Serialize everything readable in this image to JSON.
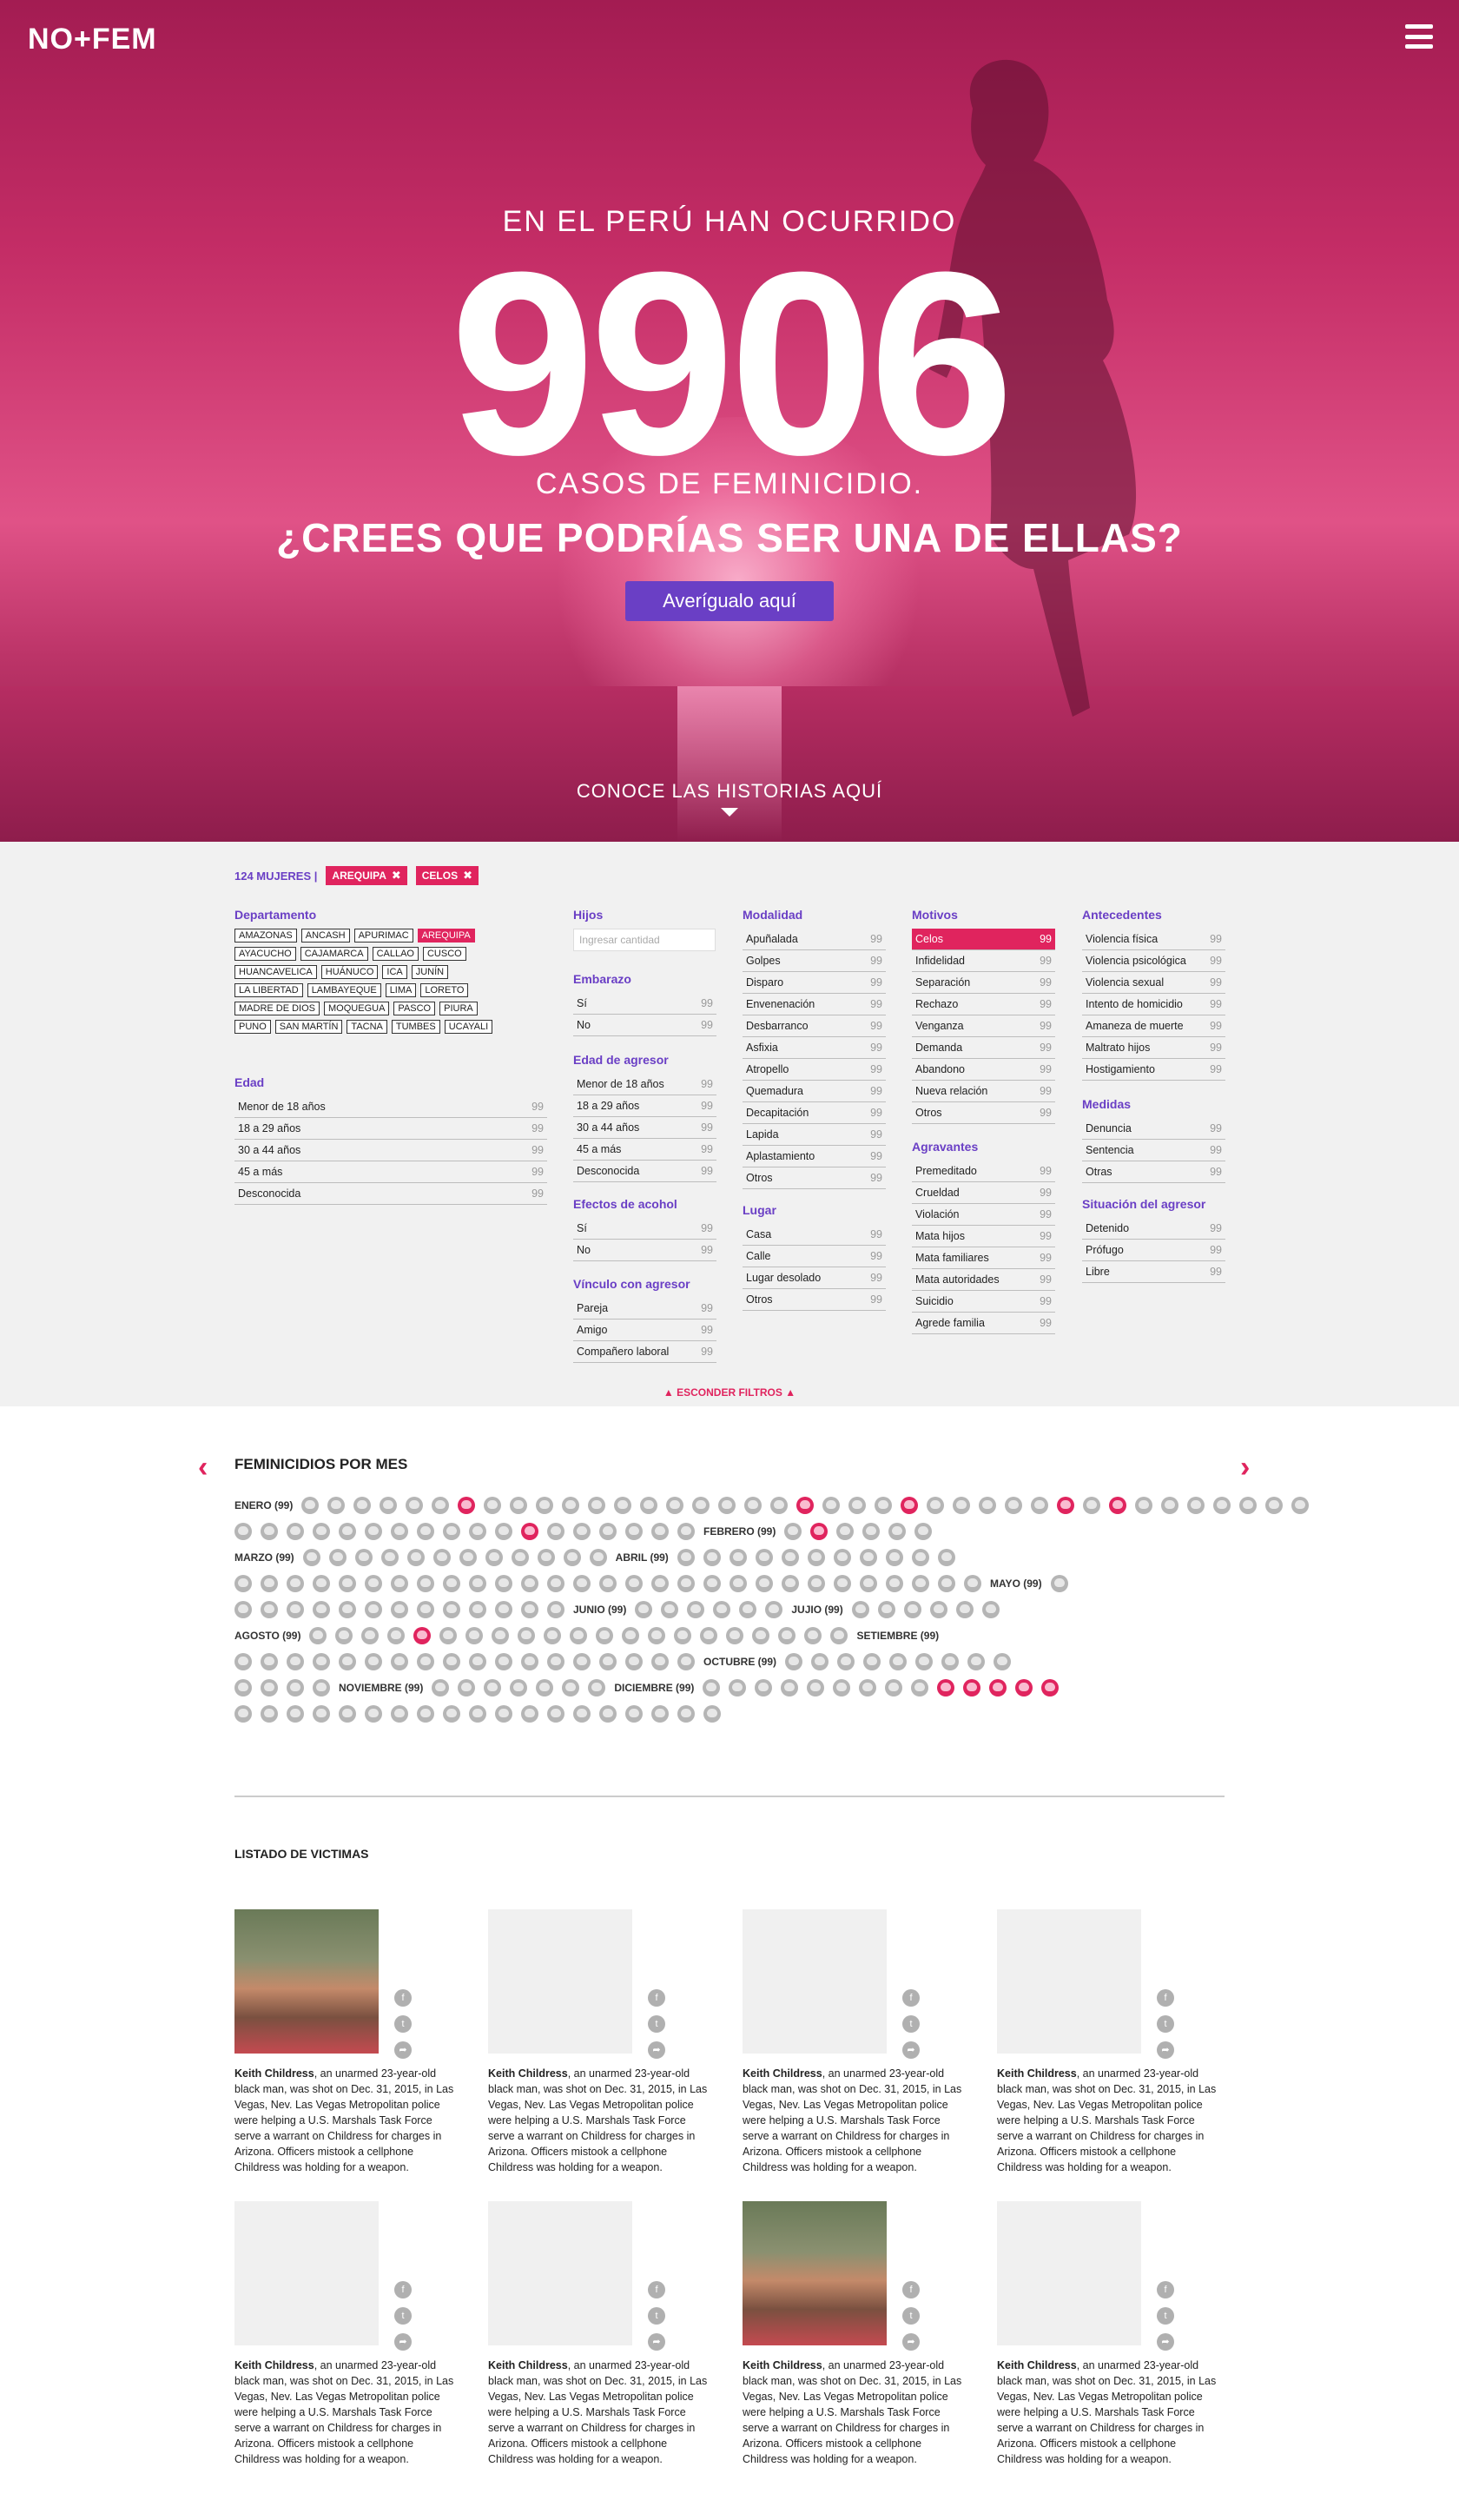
{
  "header": {
    "logo": "NO+FEM"
  },
  "hero": {
    "lead": "EN EL PERÚ HAN OCURRIDO",
    "number": "9906",
    "sub": "CASOS DE FEMINICIDIO.",
    "question": "¿CREES QUE PODRÍAS SER UNA DE ELLAS?",
    "cta": "Averígualo aquí",
    "conoce": "CONOCE LAS  HISTORIAS AQUÍ"
  },
  "filters": {
    "summary": "124 MUJERES |",
    "tags": [
      "AREQUIPA",
      "CELOS"
    ],
    "departamento": {
      "title": "Departamento",
      "items": [
        "AMAZONAS",
        "ANCASH",
        "APURIMAC",
        "AREQUIPA",
        "AYACUCHO",
        "CAJAMARCA",
        "CALLAO",
        "CUSCO",
        "HUANCAVELICA",
        "HUÁNUCO",
        "ICA",
        "JUNÍN",
        "LA LIBERTAD",
        "LAMBAYEQUE",
        "LIMA",
        "LORETO",
        "MADRE DE DIOS",
        "MOQUEGUA",
        "PASCO",
        "PIURA",
        "PUNO",
        "SAN MARTÍN",
        "TACNA",
        "TUMBES",
        "UCAYALI"
      ],
      "selected": "AREQUIPA"
    },
    "edad": {
      "title": "Edad",
      "items": [
        [
          "Menor de 18 años",
          "99"
        ],
        [
          "18 a 29 años",
          "99"
        ],
        [
          "30 a 44 años",
          "99"
        ],
        [
          "45 a más",
          "99"
        ],
        [
          "Desconocida",
          "99"
        ]
      ]
    },
    "hijos": {
      "title": "Hijos",
      "placeholder": "Ingresar cantidad"
    },
    "embarazo": {
      "title": "Embarazo",
      "items": [
        [
          "Sí",
          "99"
        ],
        [
          "No",
          "99"
        ]
      ]
    },
    "edad_agresor": {
      "title": "Edad de agresor",
      "items": [
        [
          "Menor de 18 años",
          "99"
        ],
        [
          "18 a 29 años",
          "99"
        ],
        [
          "30 a 44 años",
          "99"
        ],
        [
          "45 a más",
          "99"
        ],
        [
          "Desconocida",
          "99"
        ]
      ]
    },
    "alcohol": {
      "title": "Efectos de acohol",
      "items": [
        [
          "Sí",
          "99"
        ],
        [
          "No",
          "99"
        ]
      ]
    },
    "vinculo": {
      "title": "Vínculo con agresor",
      "items": [
        [
          "Pareja",
          "99"
        ],
        [
          "Amigo",
          "99"
        ],
        [
          "Compañero laboral",
          "99"
        ]
      ]
    },
    "modalidad": {
      "title": "Modalidad",
      "items": [
        [
          "Apuñalada",
          "99"
        ],
        [
          "Golpes",
          "99"
        ],
        [
          "Disparo",
          "99"
        ],
        [
          "Envenenación",
          "99"
        ],
        [
          "Desbarranco",
          "99"
        ],
        [
          "Asfixia",
          "99"
        ],
        [
          "Atropello",
          "99"
        ],
        [
          "Quemadura",
          "99"
        ],
        [
          "Decapitación",
          "99"
        ],
        [
          "Lapida",
          "99"
        ],
        [
          "Aplastamiento",
          "99"
        ],
        [
          "Otros",
          "99"
        ]
      ]
    },
    "lugar": {
      "title": "Lugar",
      "items": [
        [
          "Casa",
          "99"
        ],
        [
          "Calle",
          "99"
        ],
        [
          "Lugar desolado",
          "99"
        ],
        [
          "Otros",
          "99"
        ]
      ]
    },
    "motivos": {
      "title": "Motivos",
      "items": [
        [
          "Celos",
          "99"
        ],
        [
          "Infidelidad",
          "99"
        ],
        [
          "Separación",
          "99"
        ],
        [
          "Rechazo",
          "99"
        ],
        [
          "Venganza",
          "99"
        ],
        [
          "Demanda",
          "99"
        ],
        [
          "Abandono",
          "99"
        ],
        [
          "Nueva relación",
          "99"
        ],
        [
          "Otros",
          "99"
        ]
      ],
      "selected": "Celos"
    },
    "agravantes": {
      "title": "Agravantes",
      "items": [
        [
          "Premeditado",
          "99"
        ],
        [
          "Crueldad",
          "99"
        ],
        [
          "Violación",
          "99"
        ],
        [
          "Mata hijos",
          "99"
        ],
        [
          "Mata familiares",
          "99"
        ],
        [
          "Mata autoridades",
          "99"
        ],
        [
          "Suicidio",
          "99"
        ],
        [
          "Agrede familia",
          "99"
        ]
      ]
    },
    "antecedentes": {
      "title": "Antecedentes",
      "items": [
        [
          "Violencia física",
          "99"
        ],
        [
          "Violencia psicológica",
          "99"
        ],
        [
          "Violencia sexual",
          "99"
        ],
        [
          "Intento de homicidio",
          "99"
        ],
        [
          "Amaneza de muerte",
          "99"
        ],
        [
          "Maltrato hijos",
          "99"
        ],
        [
          "Hostigamiento",
          "99"
        ]
      ]
    },
    "medidas": {
      "title": "Medidas",
      "items": [
        [
          "Denuncia",
          "99"
        ],
        [
          "Sentencia",
          "99"
        ],
        [
          "Otras",
          "99"
        ]
      ]
    },
    "situacion": {
      "title": "Situación del agresor",
      "items": [
        [
          "Detenido",
          "99"
        ],
        [
          "Prófugo",
          "99"
        ],
        [
          "Libre",
          "99"
        ]
      ]
    },
    "hide": "▲ ESCONDER FILTROS ▲"
  },
  "months": {
    "title": "FEMINICIDIOS POR MES"
  },
  "victims": {
    "title": "LISTADO DE VICTIMAS",
    "name": "Keith Childress",
    "text": ", an unarmed 23-year-old black man, was shot on Dec. 31, 2015, in Las Vegas, Nev. Las Vegas Metropolitan police were helping a U.S. Marshals Task Force serve a warrant on Childress for charges in Arizona. Officers mistook a cellphone Childress was holding for a weapon."
  }
}
